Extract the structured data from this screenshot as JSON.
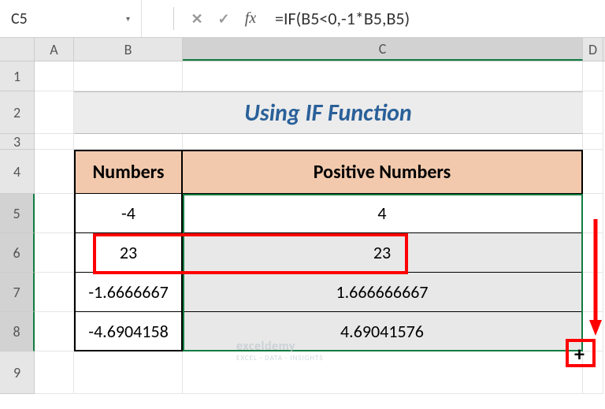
{
  "formula_bar": {
    "cell_ref": "C5",
    "fx_label": "fx",
    "formula": "=IF(B5<0,-1*B5,B5)"
  },
  "columns": {
    "a": "A",
    "b": "B",
    "c": "C",
    "d": "D"
  },
  "rows": {
    "r1": "1",
    "r2": "2",
    "r3": "3",
    "r4": "4",
    "r5": "5",
    "r6": "6",
    "r7": "7",
    "r8": "8",
    "r9": "9"
  },
  "title": "Using IF Function",
  "headers": {
    "b": "Numbers",
    "c": "Positive Numbers"
  },
  "data": {
    "b5": "-4",
    "c5": "4",
    "b6": "23",
    "c6": "23",
    "b7": "-1.6666667",
    "c7": "1.666666667",
    "b8": "-4.6904158",
    "c8": "4.69041576"
  },
  "watermark": {
    "title": "exceldemy",
    "sub": "EXCEL · DATA · INSIGHTS"
  },
  "chart_data": {
    "type": "table",
    "title": "Using IF Function",
    "columns": [
      "Numbers",
      "Positive Numbers"
    ],
    "rows": [
      [
        -4,
        4
      ],
      [
        23,
        23
      ],
      [
        -1.6666667,
        1.666666667
      ],
      [
        -4.6904158,
        4.69041576
      ]
    ]
  }
}
